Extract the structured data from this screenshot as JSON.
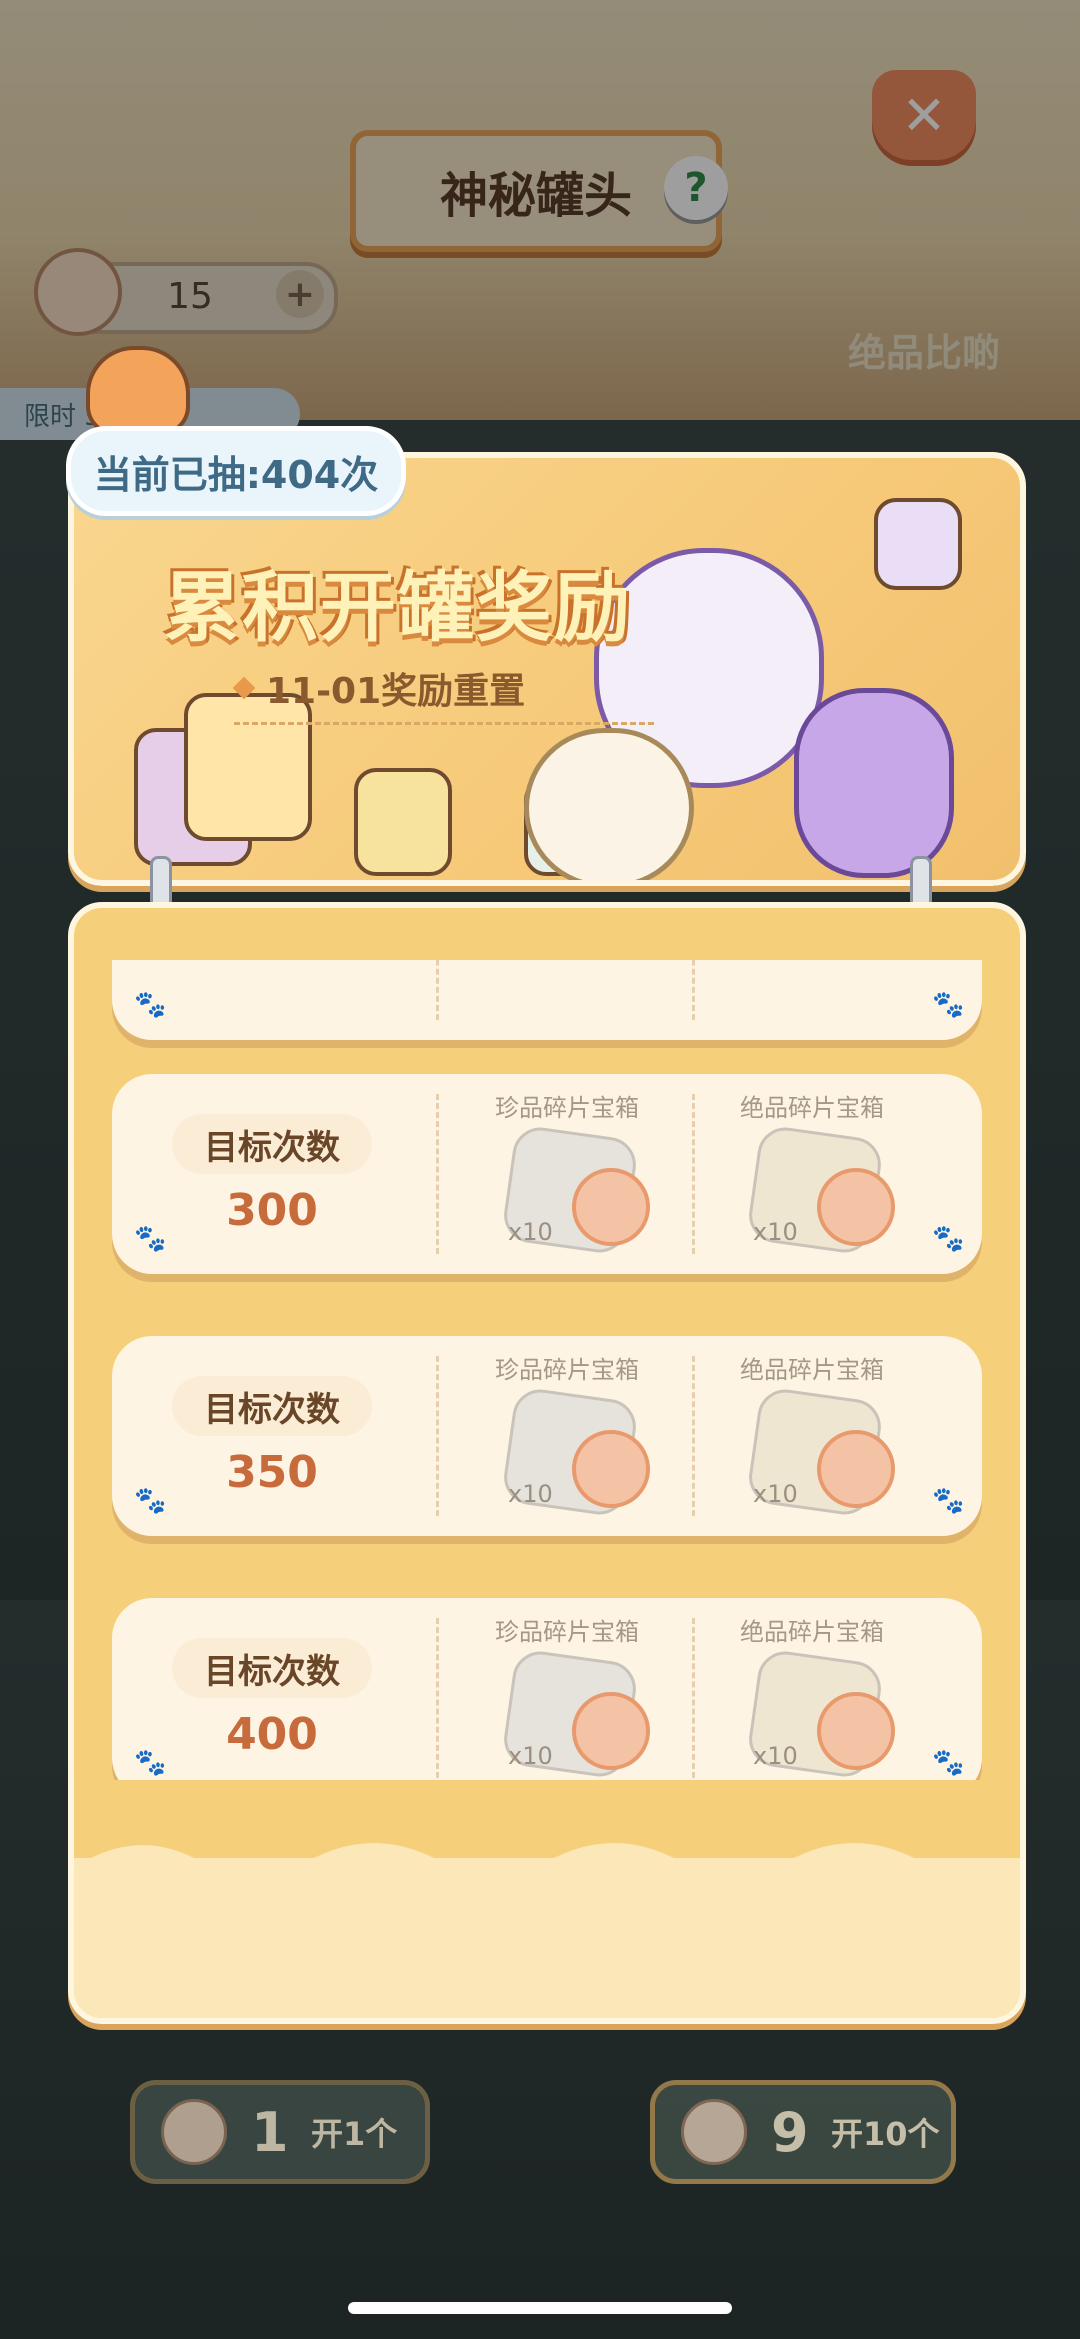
{
  "header": {
    "title": "神秘罐头",
    "help_icon": "?",
    "close_icon": "✕",
    "currency_amount": "15",
    "currency_plus": "+",
    "limited_tag": "限时  5小时",
    "rare_compare_label": "绝品比啲"
  },
  "banner": {
    "draw_counter": "当前已抽:404次",
    "title": "累积开罐奖励",
    "reset_text": "11-01奖励重置"
  },
  "rewards": {
    "target_label": "目标次数",
    "box_names": [
      "珍品碎片宝箱",
      "绝品碎片宝箱"
    ],
    "box_qty": "x10",
    "tiers": [
      {
        "target": "300"
      },
      {
        "target": "350"
      },
      {
        "target": "400"
      }
    ]
  },
  "footer": {
    "open1": {
      "cost": "1",
      "label": "开1个"
    },
    "open10": {
      "cost": "9",
      "label": "开10个"
    }
  },
  "colors": {
    "panel": "#f6cf7a",
    "card": "#fdf4e3",
    "target_number": "#c76b3c",
    "title_plaque": "#f6e6c9"
  }
}
